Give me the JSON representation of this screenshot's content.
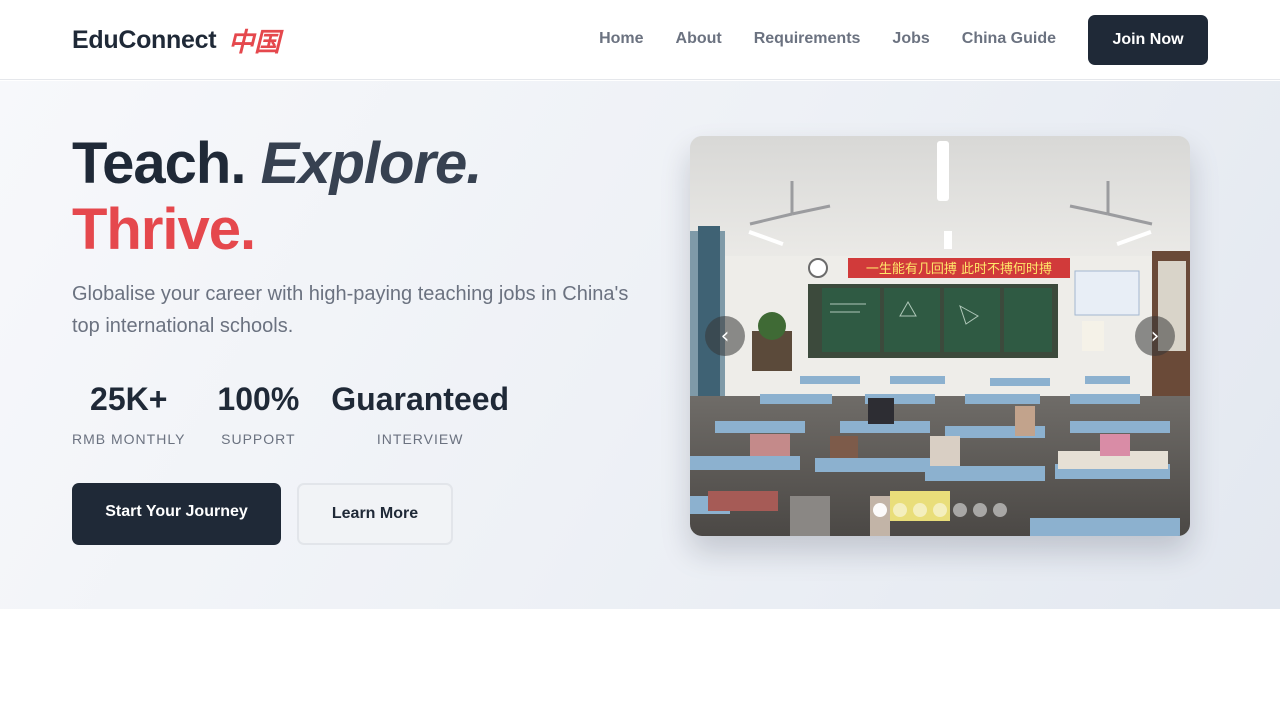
{
  "brand": {
    "name": "EduConnect",
    "cn": "中国"
  },
  "nav": {
    "links": [
      "Home",
      "About",
      "Requirements",
      "Jobs",
      "China Guide"
    ],
    "cta": "Join Now"
  },
  "hero": {
    "headline": {
      "part1": "Teach.",
      "part2": "Explore.",
      "part3": "Thrive."
    },
    "subtitle": "Globalise your career with high-paying teaching jobs in China's top international schools.",
    "stats": [
      {
        "value": "25K+",
        "label": "RMB MONTHLY"
      },
      {
        "value": "100%",
        "label": "SUPPORT"
      },
      {
        "value": "Guaranteed",
        "label": "INTERVIEW"
      }
    ],
    "primary_button": "Start Your Journey",
    "secondary_button": "Learn More"
  },
  "carousel": {
    "banner_text": "一生能有几回搏 此时不搏何时搏",
    "prev_icon": "‹",
    "next_icon": "›",
    "slide_count": 7,
    "active_index": 0
  },
  "colors": {
    "accent": "#e5484d",
    "dark": "#1f2937",
    "muted": "#6b7280"
  }
}
